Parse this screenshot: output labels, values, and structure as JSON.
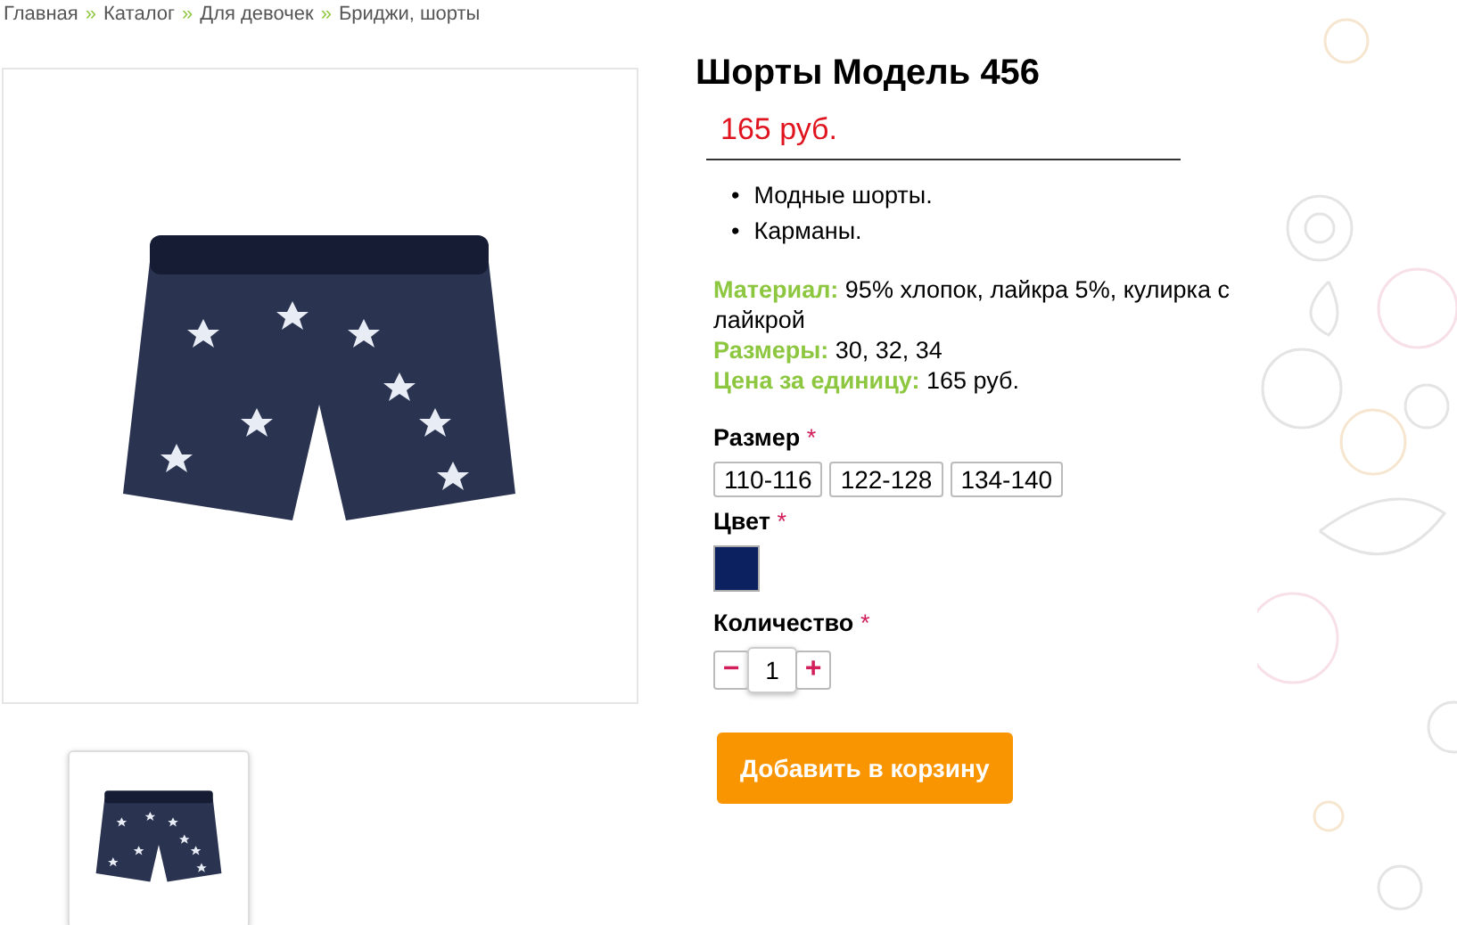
{
  "breadcrumb": {
    "separator": "»",
    "items": [
      "Главная",
      "Каталог",
      "Для девочек",
      "Бриджи, шорты"
    ]
  },
  "product": {
    "title": "Шорты Модель 456",
    "price": "165 руб.",
    "features": [
      {
        "bullet": "•",
        "text": "Модные шорты."
      },
      {
        "bullet": "•",
        "text": "Карманы."
      }
    ],
    "specs": [
      "**Материал:** 95% хлопок, лайкра 5%, кулирка с лайкрой",
      "**Размеры:** 30, 32, 34",
      "**Цена за единицу:** 165 руб."
    ]
  },
  "size": {
    "label": "Размер",
    "required": "*",
    "options": [
      {
        "label": "110-116",
        "selected": false
      },
      {
        "label": "122-128",
        "selected": false
      },
      {
        "label": "134-140",
        "selected": false
      }
    ]
  },
  "color": {
    "label": "Цвет",
    "required": "*",
    "options": [
      {
        "color": "#0c2160"
      }
    ]
  },
  "quantity": {
    "label": "Количество",
    "required": "*",
    "minus": "−",
    "value": "1",
    "plus": "+"
  },
  "add_button": "Добавить в корзину"
}
